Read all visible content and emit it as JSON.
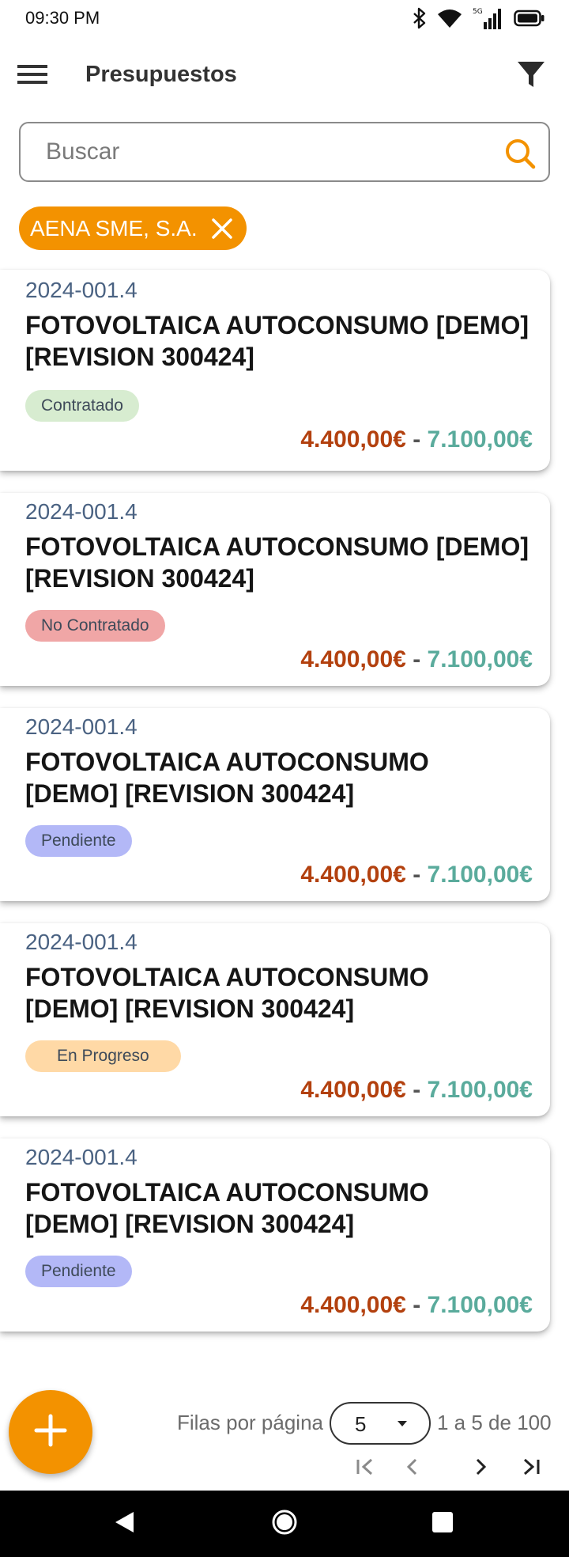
{
  "status_bar": {
    "time": "09:30 PM"
  },
  "app_bar": {
    "title": "Presupuestos"
  },
  "search": {
    "placeholder": "Buscar",
    "value": ""
  },
  "filter_chip": {
    "label": "AENA SME, S.A."
  },
  "colors": {
    "accent": "#f39200",
    "price_min": "#b3410f",
    "price_max": "#5aab9c",
    "status_contratado": "#d7ecd0",
    "status_no_contratado": "#f0a6a6",
    "status_pendiente": "#b3b8f7",
    "status_en_progreso": "#ffd9a6"
  },
  "budgets": [
    {
      "code": "2024-001.4",
      "title_lines": [
        "FOTOVOLTAICA AUTOCONSUMO [DEMO]",
        "[REVISION 300424]"
      ],
      "status": "Contratado",
      "price_min": "4.400,00€",
      "separator": "-",
      "price_max": "7.100,00€"
    },
    {
      "code": "2024-001.4",
      "title_lines": [
        "FOTOVOLTAICA AUTOCONSUMO [DEMO]",
        "[REVISION 300424]"
      ],
      "status": "No Contratado",
      "price_min": "4.400,00€",
      "separator": "-",
      "price_max": "7.100,00€"
    },
    {
      "code": "2024-001.4",
      "title_lines": [
        "FOTOVOLTAICA AUTOCONSUMO",
        "[DEMO] [REVISION 300424]"
      ],
      "status": "Pendiente",
      "price_min": "4.400,00€",
      "separator": "-",
      "price_max": "7.100,00€"
    },
    {
      "code": "2024-001.4",
      "title_lines": [
        "FOTOVOLTAICA AUTOCONSUMO",
        "[DEMO] [REVISION 300424]"
      ],
      "status": "En Progreso",
      "price_min": "4.400,00€",
      "separator": "-",
      "price_max": "7.100,00€"
    },
    {
      "code": "2024-001.4",
      "title_lines": [
        "FOTOVOLTAICA AUTOCONSUMO",
        "[DEMO] [REVISION 300424]"
      ],
      "status": "Pendiente",
      "price_min": "4.400,00€",
      "separator": "-",
      "price_max": "7.100,00€"
    }
  ],
  "pagination": {
    "rows_label": "Filas por página",
    "rows_value": "5",
    "range_text": "1 a 5 de 100"
  },
  "icons": {
    "menu": "menu-icon",
    "filter": "filter-icon",
    "search": "search-icon",
    "chip_close": "close-icon",
    "fab": "plus-icon",
    "first_page": "first-page-icon",
    "prev_page": "chevron-left-icon",
    "next_page": "chevron-right-icon",
    "last_page": "last-page-icon"
  }
}
